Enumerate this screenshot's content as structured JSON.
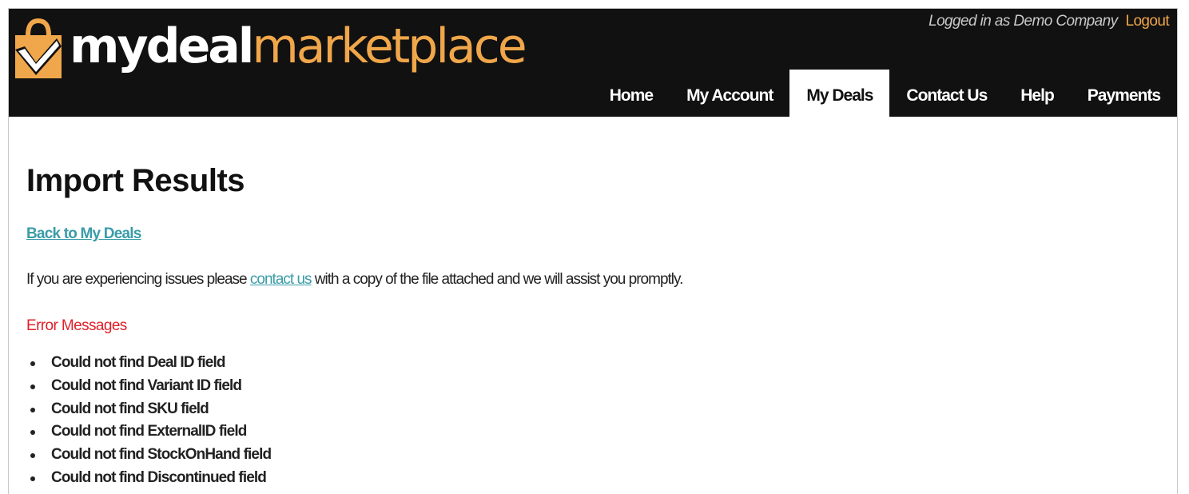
{
  "brand": {
    "logo_my_deal": "mydeal",
    "logo_marketplace": "marketplace",
    "icon": "shopping-bag-check-icon",
    "colors": {
      "header_bg": "#111111",
      "accent_orange": "#f0a64a",
      "link_teal": "#3a9ca8",
      "error_red": "#e0202a"
    }
  },
  "header": {
    "login_text": "Logged in as Demo Company",
    "logout_label": "Logout"
  },
  "nav": {
    "items": [
      {
        "label": "Home",
        "active": false
      },
      {
        "label": "My Account",
        "active": false
      },
      {
        "label": "My Deals",
        "active": true
      },
      {
        "label": "Contact Us",
        "active": false
      },
      {
        "label": "Help",
        "active": false
      },
      {
        "label": "Payments",
        "active": false
      }
    ]
  },
  "main": {
    "title": "Import Results",
    "back_link": "Back to My Deals",
    "info_prefix": "If you are experiencing issues please ",
    "info_link": "contact us",
    "info_suffix": " with a copy of the file attached and we will assist you promptly.",
    "errors_heading": "Error Messages",
    "errors": [
      "Could not find Deal ID field",
      "Could not find Variant ID field",
      "Could not find SKU field",
      "Could not find ExternalID field",
      "Could not find StockOnHand field",
      "Could not find Discontinued field"
    ]
  }
}
